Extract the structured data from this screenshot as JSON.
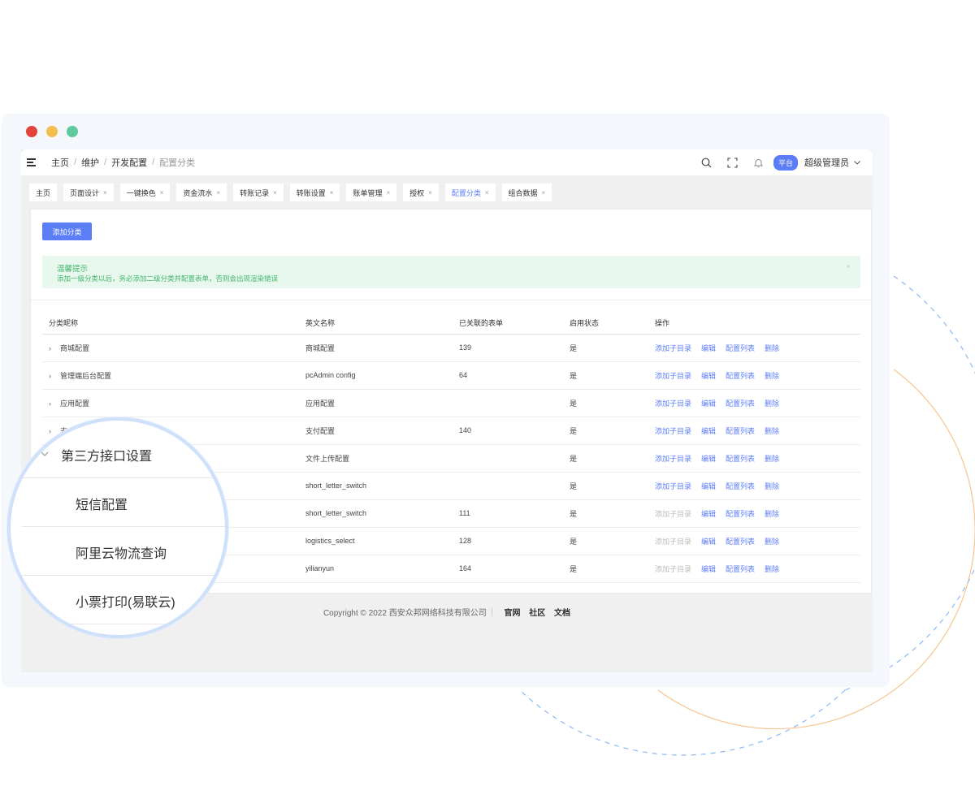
{
  "window": {
    "dot_colors": [
      "#e0443a",
      "#f5bf4f",
      "#5fc9a0"
    ]
  },
  "header": {
    "breadcrumb": [
      "主页",
      "维护",
      "开发配置",
      "配置分类"
    ],
    "badge": "平台",
    "user": "超级管理员"
  },
  "tabs": [
    {
      "label": "主页",
      "closable": false
    },
    {
      "label": "页面设计",
      "closable": true
    },
    {
      "label": "一键换色",
      "closable": true
    },
    {
      "label": "资金流水",
      "closable": true
    },
    {
      "label": "转账记录",
      "closable": true
    },
    {
      "label": "转账设置",
      "closable": true
    },
    {
      "label": "账单管理",
      "closable": true
    },
    {
      "label": "授权",
      "closable": true
    },
    {
      "label": "配置分类",
      "closable": true,
      "active": true
    },
    {
      "label": "组合数据",
      "closable": true
    }
  ],
  "toolbar": {
    "add_label": "添加分类"
  },
  "notice": {
    "title": "温馨提示",
    "text": "添加一级分类以后，务必添加二级分类并配置表单，否则会出现渲染错误",
    "close": "×"
  },
  "table": {
    "headers": [
      "分类昵称",
      "英文名称",
      "已关联的表单",
      "启用状态",
      "操作"
    ],
    "rows": [
      {
        "name": "商城配置",
        "en": "商城配置",
        "count": "139",
        "status": "是",
        "add_enabled": true
      },
      {
        "name": "管理端后台配置",
        "en": "pcAdmin config",
        "count": "64",
        "status": "是",
        "add_enabled": true
      },
      {
        "name": "应用配置",
        "en": "应用配置",
        "count": "",
        "status": "是",
        "add_enabled": true
      },
      {
        "name": "支",
        "en": "支付配置",
        "count": "140",
        "status": "是",
        "add_enabled": true
      },
      {
        "name": "",
        "en": "文件上传配置",
        "count": "",
        "status": "是",
        "add_enabled": true
      },
      {
        "name": "",
        "en": "short_letter_switch",
        "count": "",
        "status": "是",
        "add_enabled": true
      },
      {
        "name": "",
        "en": "short_letter_switch",
        "count": "111",
        "status": "是",
        "add_enabled": false
      },
      {
        "name": "",
        "en": "logistics_select",
        "count": "128",
        "status": "是",
        "add_enabled": false
      },
      {
        "name": "",
        "en": "yilianyun",
        "count": "164",
        "status": "是",
        "add_enabled": false
      }
    ],
    "ops": [
      "添加子目录",
      "编辑",
      "配置列表",
      "删除"
    ]
  },
  "footer": {
    "copyright": "Copyright © 2022 西安众邦网络科技有限公司",
    "links": [
      "官网",
      "社区",
      "文档"
    ]
  },
  "magnifier": {
    "parent": "第三方接口设置",
    "children": [
      "短信配置",
      "阿里云物流查询",
      "小票打印(易联云)"
    ]
  }
}
